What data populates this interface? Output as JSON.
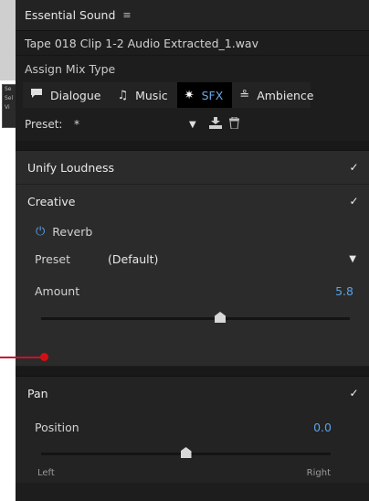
{
  "panel": {
    "title": "Essential Sound",
    "menu_icon": "hamburger-menu-icon",
    "clip_name": "Tape 018 Clip 1-2 Audio Extracted_1.wav",
    "assign_label": "Assign Mix Type"
  },
  "types": [
    {
      "label": "Dialogue",
      "icon": "speech-bubble-icon",
      "active": false
    },
    {
      "label": "Music",
      "icon": "music-note-icon",
      "active": false
    },
    {
      "label": "SFX",
      "icon": "burst-icon",
      "active": true
    },
    {
      "label": "Ambience",
      "icon": "wind-icon",
      "active": false
    }
  ],
  "preset": {
    "label": "Preset:",
    "value": "*"
  },
  "unify": {
    "label": "Unify Loudness",
    "checked": true
  },
  "creative": {
    "label": "Creative",
    "checked": true,
    "reverb_label": "Reverb",
    "preset_label": "Preset",
    "preset_value": "(Default)",
    "amount_label": "Amount",
    "amount_value": "5.8",
    "amount_fraction": 0.58
  },
  "pan": {
    "label": "Pan",
    "checked": true,
    "position_label": "Position",
    "position_value": "0.0",
    "position_fraction": 0.5,
    "left_label": "Left",
    "right_label": "Right"
  },
  "colors": {
    "accent": "#5aa2e6",
    "annotation": "#d40f14"
  }
}
